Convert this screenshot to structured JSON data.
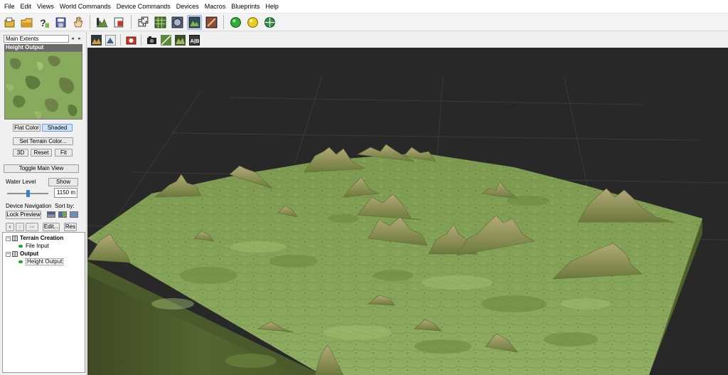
{
  "menu": [
    "File",
    "Edit",
    "Views",
    "World Commands",
    "Device Commands",
    "Devices",
    "Macros",
    "Blueprints",
    "Help"
  ],
  "toolbar": {
    "buttons": [
      "new-icon",
      "open-icon",
      "help-icon",
      "save-icon",
      "hand-icon",
      "terrain-icon",
      "export-icon",
      "dice-icon",
      "grid-icon",
      "globe-view-icon",
      "terrain-view-icon",
      "texture-icon",
      "green-light-icon",
      "yellow-light-icon",
      "world-icon"
    ],
    "active": "terrain-view-icon"
  },
  "left_panel": {
    "extents_value": "Main Extents",
    "preview_title": "Height Output",
    "flat_color": "Flat Color",
    "shaded": "Shaded",
    "set_terrain_color": "Set Terrain Color...",
    "btn_3d": "3D",
    "btn_reset": "Reset",
    "btn_fit": "Fit",
    "toggle_main_view": "Toggle Main View",
    "water_level_label": "Water Level",
    "show_label": "Show",
    "water_value": "1150 m",
    "water_fraction": 0.5,
    "device_navigation": "Device Navigation",
    "sort_by": "Sort by:",
    "lock_preview": "Lock Preview",
    "edit_btn": "Edit...",
    "res_btn": "Res"
  },
  "tree": [
    {
      "label": "Terrain Creation",
      "bold": true,
      "children": [
        {
          "label": "File Input"
        }
      ]
    },
    {
      "label": "Output",
      "bold": true,
      "children": [
        {
          "label": "Height Output",
          "selected": true
        }
      ]
    }
  ],
  "viewport_toolbar": [
    "orbit-icon",
    "flight-icon",
    "camera-icon",
    "snapshot-icon",
    "grid-toggle-icon",
    "terrain-view-icon",
    "ab-compare-icon"
  ],
  "viewport_toolbar_ab": "A|B",
  "colors": {
    "terrain": "#85a35a",
    "terrain_dark": "#5b7335",
    "background": "#282828",
    "cliff": "#4c5b2e"
  }
}
